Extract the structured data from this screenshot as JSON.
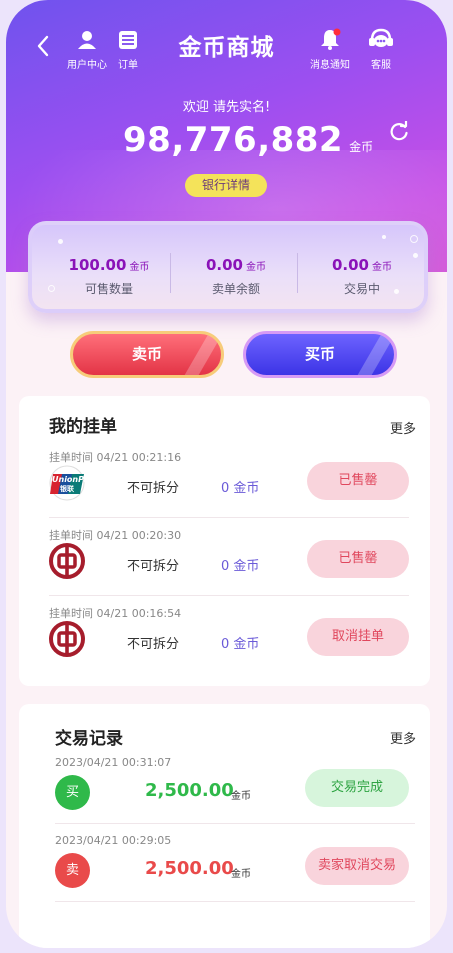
{
  "header": {
    "title": "金币商城",
    "user_center": "用户中心",
    "orders": "订单",
    "notifications": "消息通知",
    "service": "客服"
  },
  "hero": {
    "welcome": "欢迎 请先实名!",
    "balance": "98,776,882",
    "balance_unit": "金币",
    "bank_details": "银行详情"
  },
  "stats": [
    {
      "value": "100.00",
      "unit": "金币",
      "label": "可售数量"
    },
    {
      "value": "0.00",
      "unit": "金币",
      "label": "卖单余额"
    },
    {
      "value": "0.00",
      "unit": "金币",
      "label": "交易中"
    }
  ],
  "actions": {
    "sell": "卖币",
    "buy": "买币"
  },
  "my_orders": {
    "title": "我的挂单",
    "more": "更多",
    "items": [
      {
        "time": "挂单时间 04/21 00:21:16",
        "bank": "unionpay-logo",
        "type": "不可拆分",
        "amount": "0 金币",
        "status": "已售罄"
      },
      {
        "time": "挂单时间 04/21 00:20:30",
        "bank": "bank-of-china-logo",
        "type": "不可拆分",
        "amount": "0 金币",
        "status": "已售罄"
      },
      {
        "time": "挂单时间 04/21 00:16:54",
        "bank": "bank-of-china-logo",
        "type": "不可拆分",
        "amount": "0 金币",
        "status": "取消挂单"
      }
    ]
  },
  "records": {
    "title": "交易记录",
    "more": "更多",
    "items": [
      {
        "time": "2023/04/21  00:31:07",
        "badge": "买",
        "amount": "2,500.00",
        "unit": "金币",
        "status": "交易完成",
        "color": "#2fb94a"
      },
      {
        "time": "2023/04/21  00:29:05",
        "badge": "卖",
        "amount": "2,500.00",
        "unit": "金币",
        "status": "卖家取消交易",
        "color": "#e94a4a"
      }
    ]
  },
  "colors": {
    "accent_purple": "#8a12b8",
    "sell_red": "#e33446",
    "buy_blue": "#3c34e6"
  }
}
